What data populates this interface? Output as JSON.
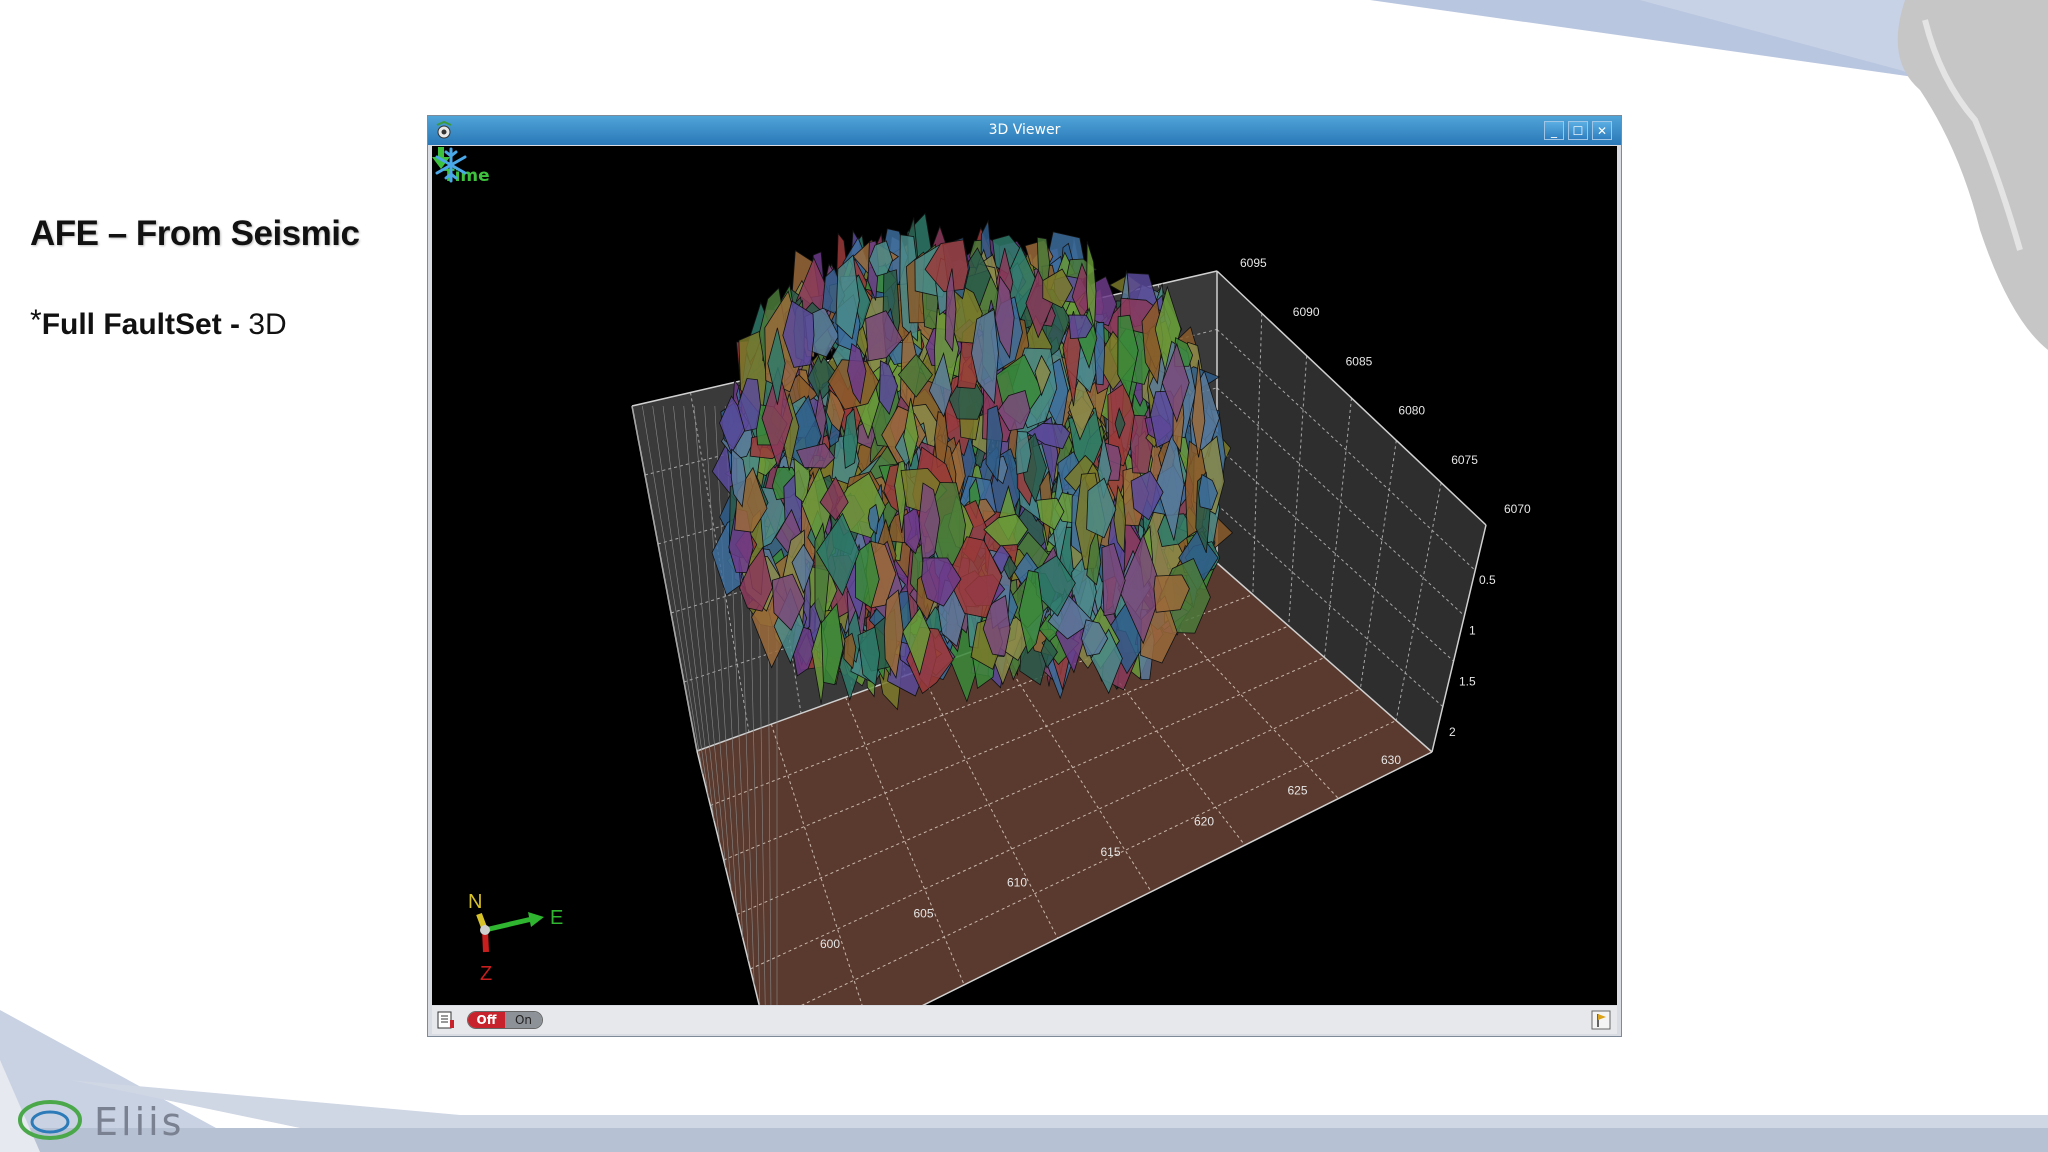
{
  "slide": {
    "title": "AFE – From Seismic",
    "bullet_star": "*",
    "bullet_bold": "Full FaultSet - ",
    "bullet_normal": "3D",
    "logo_text": "Eliis"
  },
  "window": {
    "title": "3D Viewer",
    "app_icon": "viewer-eye-icon",
    "buttons": {
      "minimize": "_",
      "maximize": "☐",
      "close": "✕"
    }
  },
  "viewer": {
    "time_label": "Time",
    "time_icon": "down-arrow-icon",
    "freeze_icon": "snowflake-icon",
    "axes": {
      "y_ticks": [
        "6095",
        "6090",
        "6085",
        "6080",
        "6075",
        "6070"
      ],
      "z_ticks": [
        "0.5",
        "1",
        "1.5",
        "2"
      ],
      "x_ticks": [
        "600",
        "605",
        "610",
        "615",
        "620",
        "625",
        "630"
      ]
    },
    "compass": {
      "n": "N",
      "e": "E",
      "z": "Z"
    },
    "colors": {
      "floor": "#5a3a2e",
      "walls": "#3d3d3d",
      "grid": "#bdbdbd",
      "background": "#000000"
    }
  },
  "statusbar": {
    "toggle_off": "Off",
    "toggle_on": "On",
    "left_icon": "report-icon",
    "right_icon": "flag-icon"
  }
}
